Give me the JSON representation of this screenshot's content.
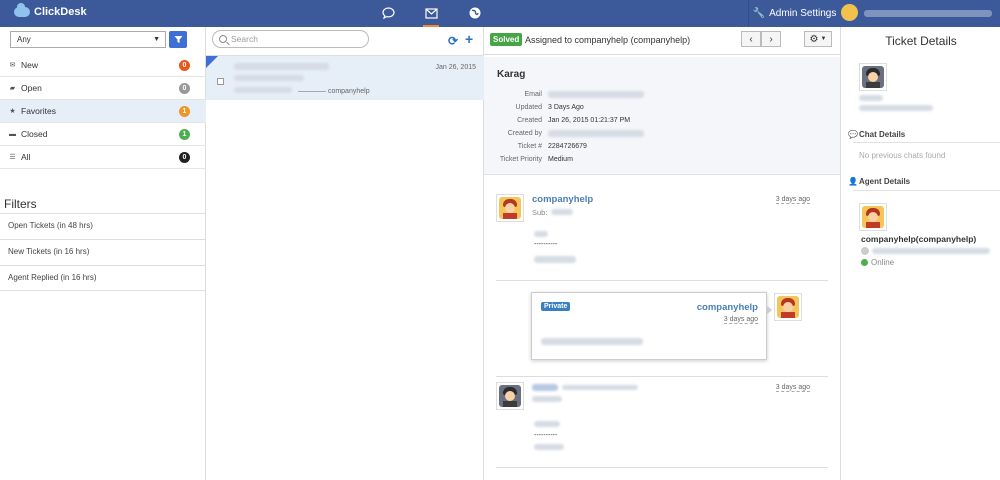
{
  "app": {
    "name": "ClickDesk",
    "admin_label": "Admin Settings"
  },
  "sidebar": {
    "filter_select_value": "Any",
    "items": [
      {
        "label": "New",
        "count": "0",
        "color": "#e8581c"
      },
      {
        "label": "Open",
        "count": "0",
        "color": "#999999"
      },
      {
        "label": "Favorites",
        "count": "1",
        "color": "#f0952a"
      },
      {
        "label": "Closed",
        "count": "1",
        "color": "#4caf50"
      },
      {
        "label": "All",
        "count": "0",
        "color": "#222222"
      }
    ],
    "filters_title": "Filters",
    "filters": [
      "Open Tickets (in 48 hrs)",
      "New Tickets (in 16 hrs)",
      "Agent Replied (in 16 hrs)"
    ]
  },
  "ticket_list": {
    "search_placeholder": "Search",
    "ticket": {
      "date": "Jan 26, 2015",
      "from": "———— companyhelp"
    }
  },
  "ticket": {
    "status": "Solved",
    "assigned": "Assigned to companyhelp (companyhelp)",
    "customer": "Karag",
    "fields": {
      "email_label": "Email",
      "updated_label": "Updated",
      "updated_value": "3 Days Ago",
      "created_label": "Created",
      "created_value": "Jan 26, 2015 01:21:37 PM",
      "created_by_label": "Created by",
      "ticket_no_label": "Ticket #",
      "ticket_no_value": "2284726679",
      "priority_label": "Ticket Priority",
      "priority_value": "Medium"
    },
    "messages": [
      {
        "author": "companyhelp",
        "sub_label": "Sub:",
        "ago": "3 days ago",
        "divider": "----------"
      },
      {
        "tag": "Private",
        "author": "companyhelp",
        "ago": "3 days ago"
      },
      {
        "ago": "3 days ago",
        "divider": "----------"
      }
    ]
  },
  "details": {
    "title": "Ticket Details",
    "chat_details": "Chat Details",
    "no_chats": "No previous chats found",
    "agent_details": "Agent Details",
    "agent_name": "companyhelp(companyhelp)",
    "agent_status": "Online"
  }
}
